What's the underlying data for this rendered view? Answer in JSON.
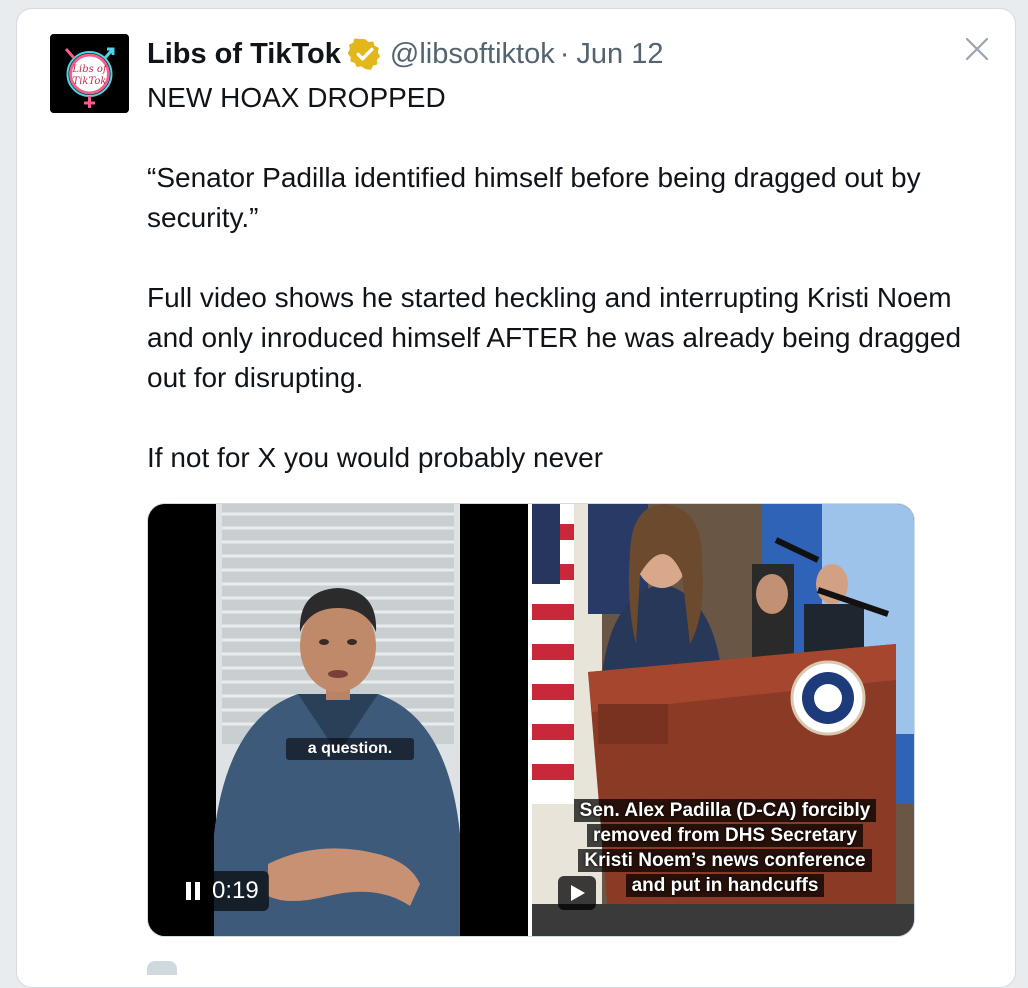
{
  "tweet": {
    "author": {
      "display_name": "Libs of TikTok",
      "handle": "@libsoftiktok",
      "verified": true,
      "verified_badge_color": "#e2b719",
      "avatar_icon": "libs-of-tiktok-logo-icon",
      "avatar_logo_text": [
        "Libs of",
        "TikTok"
      ]
    },
    "separator": "·",
    "date": "Jun 12",
    "paragraphs": [
      "NEW HOAX DROPPED",
      "“Senator Padilla identified himself before being dragged out by security.”",
      "Full video shows he started heckling and interrupting Kristi Noem and only inroduced himself AFTER he was already being dragged out for disrupting.",
      "If not for X you would probably never"
    ],
    "close_icon": "close-icon",
    "media": {
      "left_video": {
        "caption": "a question.",
        "state": "playing",
        "control_icon": "pause-icon",
        "timestamp": "0:19"
      },
      "right_video": {
        "caption_lines": [
          "Sen. Alex Padilla (D-CA) forcibly",
          "removed from DHS Secretary",
          "Kristi Noem’s news conference",
          "and put in handcuffs"
        ],
        "control_icon": "play-icon"
      }
    }
  }
}
